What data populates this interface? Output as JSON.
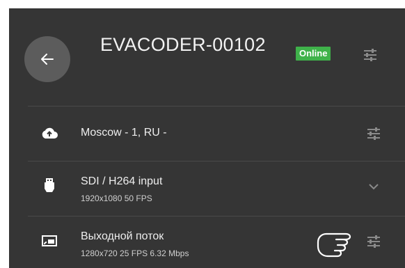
{
  "device": {
    "name": "EVACODER-00102",
    "status": "Online",
    "status_color": "#3fb24a"
  },
  "rows": [
    {
      "icon": "cloud-upload-icon",
      "title": "Moscow - 1, RU  -",
      "subtitle": "",
      "action_icon": "tune-icon"
    },
    {
      "icon": "hdmi-connector-icon",
      "title": "SDI / H264 input",
      "subtitle": "1920x1080 50 FPS",
      "action_icon": "chevron-down-icon"
    },
    {
      "icon": "cast-output-icon",
      "title": "Выходной поток",
      "subtitle": "1280x720 25 FPS 6.32 Mbps",
      "action_icon": "tune-icon"
    }
  ],
  "colors": {
    "panel_bg": "#353535",
    "back_button_bg": "#5c5c5c",
    "text_primary": "#f2f2f2",
    "icon_muted": "#8a8a8a"
  }
}
